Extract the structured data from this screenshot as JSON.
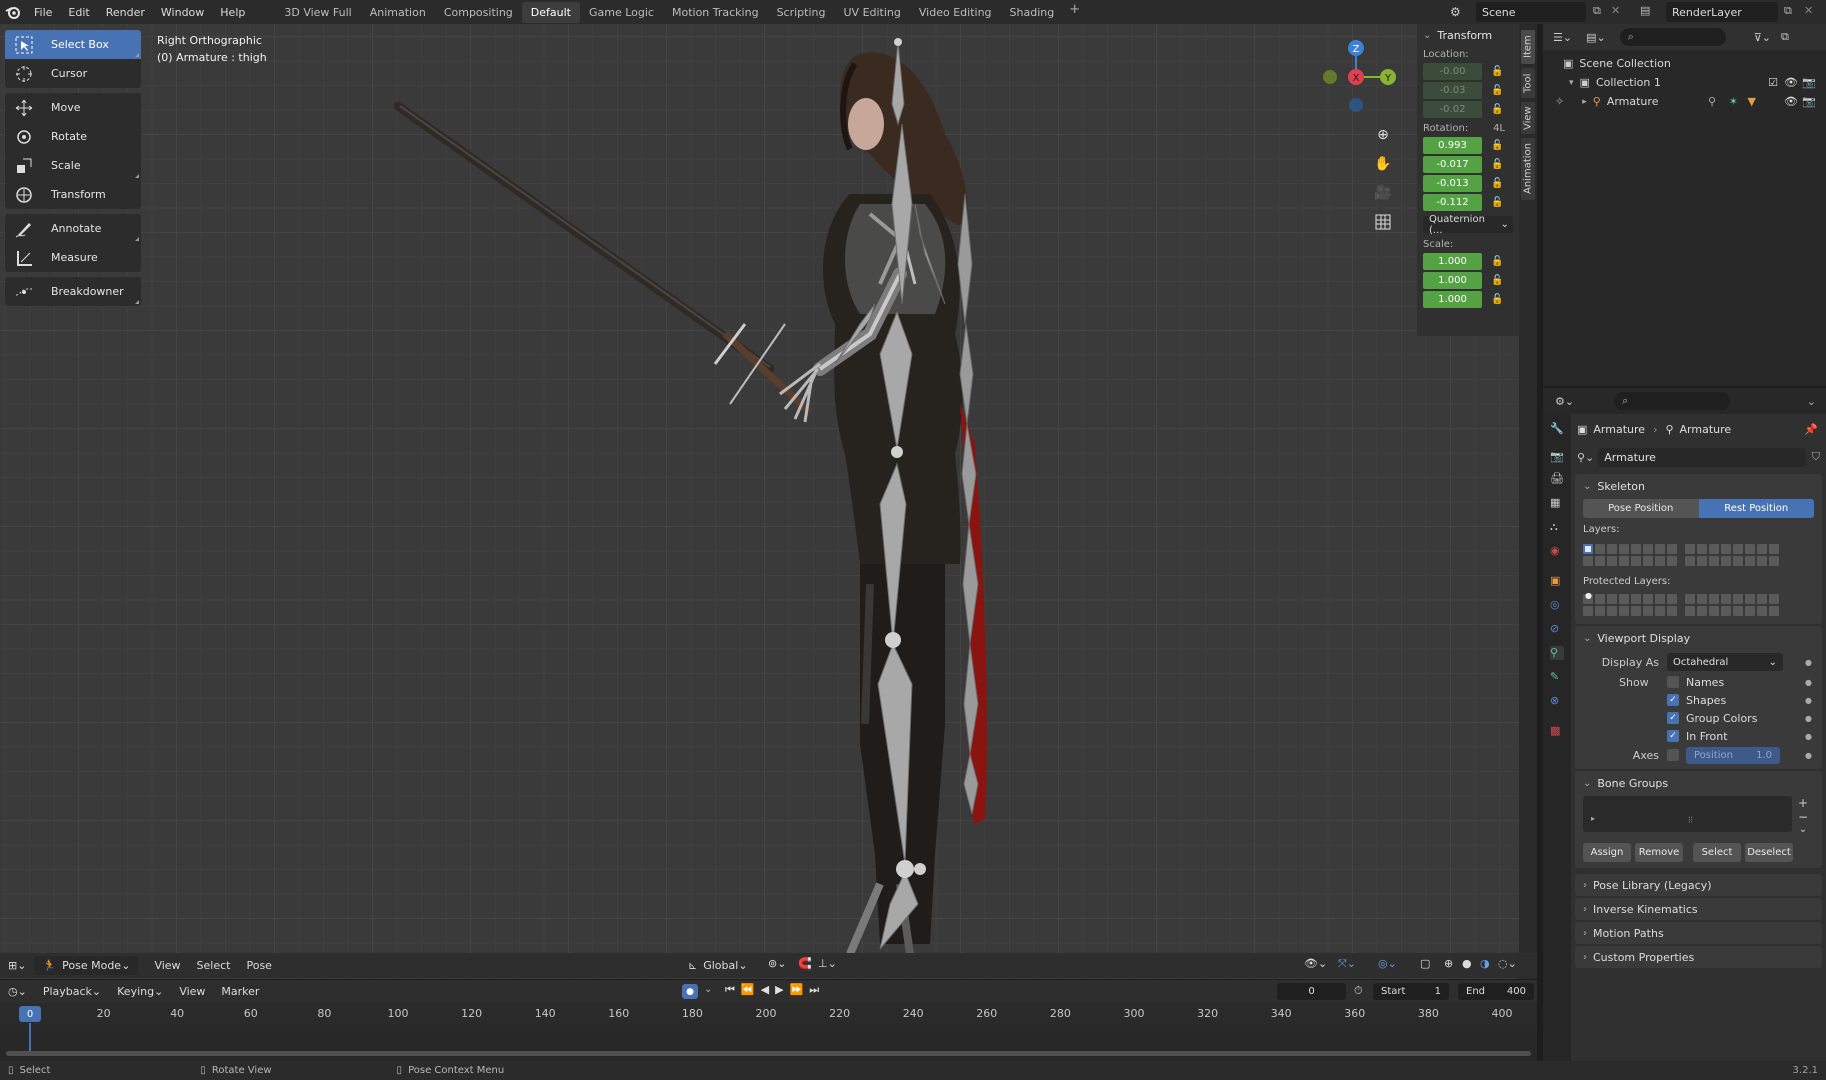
{
  "topbar": {
    "menus": [
      "File",
      "Edit",
      "Render",
      "Window",
      "Help"
    ],
    "workspaces": [
      "3D View Full",
      "Animation",
      "Compositing",
      "Default",
      "Game Logic",
      "Motion Tracking",
      "Scripting",
      "UV Editing",
      "Video Editing",
      "Shading"
    ],
    "active_workspace": "Default",
    "add_workspace": "+",
    "scene": "Scene",
    "view_layer": "RenderLayer"
  },
  "viewport": {
    "view_name": "Right Orthographic",
    "active_info": "(0) Armature : thigh"
  },
  "toolbar": {
    "tools": [
      "Select Box",
      "Cursor",
      "Move",
      "Rotate",
      "Scale",
      "Transform",
      "Annotate",
      "Measure",
      "Breakdowner"
    ],
    "active": "Select Box"
  },
  "gizmo": {
    "z": "Z",
    "y": "Y",
    "x": "X"
  },
  "npanel": {
    "title": "Transform",
    "location_label": "Location:",
    "location": [
      "-0.00",
      "-0.03",
      "-0.02"
    ],
    "rotation_label": "Rotation:",
    "rotation_mode_short": "4L",
    "rotation": [
      "0.993",
      "-0.017",
      "-0.013",
      "-0.112"
    ],
    "rotation_mode": "Quaternion (...",
    "scale_label": "Scale:",
    "scale": [
      "1.000",
      "1.000",
      "1.000"
    ]
  },
  "sidetabs": [
    "Item",
    "Tool",
    "View",
    "Animation"
  ],
  "vpheader": {
    "mode": "Pose Mode",
    "menus": [
      "View",
      "Select",
      "Pose"
    ],
    "orientation": "Global"
  },
  "timeline": {
    "menus": [
      "Playback",
      "Keying",
      "View",
      "Marker"
    ],
    "current_frame": "0",
    "start_label": "Start",
    "start": "1",
    "end_label": "End",
    "end": "400",
    "ticks": [
      "0",
      "20",
      "40",
      "60",
      "80",
      "100",
      "120",
      "140",
      "160",
      "180",
      "200",
      "220",
      "240",
      "260",
      "280",
      "300",
      "320",
      "340",
      "360",
      "380",
      "400"
    ],
    "playhead": "0"
  },
  "statusbar": {
    "items": [
      "Select",
      "Rotate View",
      "Pose Context Menu"
    ],
    "version": "3.2.1"
  },
  "outliner": {
    "rows": [
      "Scene Collection",
      "Collection 1",
      "Armature"
    ]
  },
  "properties": {
    "breadcrumb": [
      "Armature",
      "Armature"
    ],
    "datablock": "Armature",
    "skeleton": {
      "title": "Skeleton",
      "pose_position": "Pose Position",
      "rest_position": "Rest Position",
      "layers_label": "Layers:",
      "protected_label": "Protected Layers:"
    },
    "viewport_display": {
      "title": "Viewport Display",
      "display_as_label": "Display As",
      "display_as": "Octahedral",
      "show_label": "Show",
      "options": [
        {
          "label": "Names",
          "checked": false
        },
        {
          "label": "Shapes",
          "checked": true
        },
        {
          "label": "Group Colors",
          "checked": true
        },
        {
          "label": "In Front",
          "checked": true
        }
      ],
      "axes_label": "Axes",
      "axes_position_label": "Position",
      "axes_position_value": "1.0"
    },
    "bone_groups": {
      "title": "Bone Groups",
      "buttons": [
        "Assign",
        "Remove",
        "Select",
        "Deselect"
      ]
    },
    "collapsed": [
      "Pose Library (Legacy)",
      "Inverse Kinematics",
      "Motion Paths",
      "Custom Properties"
    ]
  },
  "colors": {
    "accent": "#4772b3",
    "field_green": "#54a243",
    "axis_x": "#e04050",
    "axis_y": "#8ab331",
    "axis_z": "#3b82d6"
  }
}
